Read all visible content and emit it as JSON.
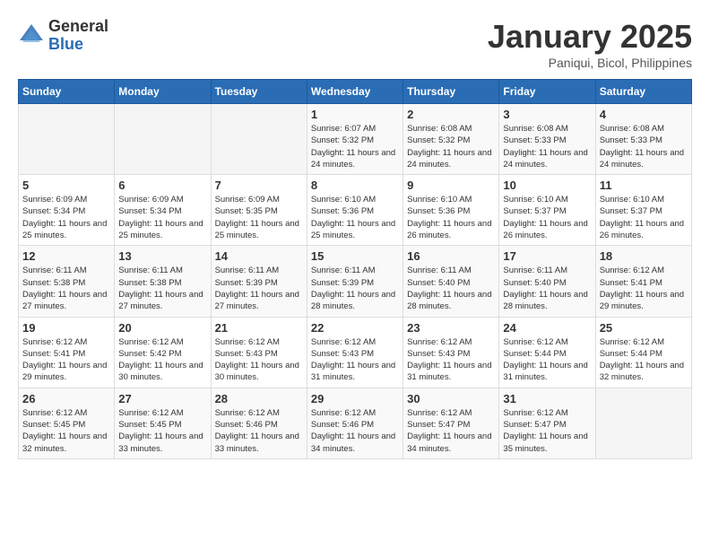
{
  "header": {
    "logo_general": "General",
    "logo_blue": "Blue",
    "month_title": "January 2025",
    "location": "Paniqui, Bicol, Philippines"
  },
  "weekdays": [
    "Sunday",
    "Monday",
    "Tuesday",
    "Wednesday",
    "Thursday",
    "Friday",
    "Saturday"
  ],
  "weeks": [
    [
      {
        "day": "",
        "sunrise": "",
        "sunset": "",
        "daylight": ""
      },
      {
        "day": "",
        "sunrise": "",
        "sunset": "",
        "daylight": ""
      },
      {
        "day": "",
        "sunrise": "",
        "sunset": "",
        "daylight": ""
      },
      {
        "day": "1",
        "sunrise": "Sunrise: 6:07 AM",
        "sunset": "Sunset: 5:32 PM",
        "daylight": "Daylight: 11 hours and 24 minutes."
      },
      {
        "day": "2",
        "sunrise": "Sunrise: 6:08 AM",
        "sunset": "Sunset: 5:32 PM",
        "daylight": "Daylight: 11 hours and 24 minutes."
      },
      {
        "day": "3",
        "sunrise": "Sunrise: 6:08 AM",
        "sunset": "Sunset: 5:33 PM",
        "daylight": "Daylight: 11 hours and 24 minutes."
      },
      {
        "day": "4",
        "sunrise": "Sunrise: 6:08 AM",
        "sunset": "Sunset: 5:33 PM",
        "daylight": "Daylight: 11 hours and 24 minutes."
      }
    ],
    [
      {
        "day": "5",
        "sunrise": "Sunrise: 6:09 AM",
        "sunset": "Sunset: 5:34 PM",
        "daylight": "Daylight: 11 hours and 25 minutes."
      },
      {
        "day": "6",
        "sunrise": "Sunrise: 6:09 AM",
        "sunset": "Sunset: 5:34 PM",
        "daylight": "Daylight: 11 hours and 25 minutes."
      },
      {
        "day": "7",
        "sunrise": "Sunrise: 6:09 AM",
        "sunset": "Sunset: 5:35 PM",
        "daylight": "Daylight: 11 hours and 25 minutes."
      },
      {
        "day": "8",
        "sunrise": "Sunrise: 6:10 AM",
        "sunset": "Sunset: 5:36 PM",
        "daylight": "Daylight: 11 hours and 25 minutes."
      },
      {
        "day": "9",
        "sunrise": "Sunrise: 6:10 AM",
        "sunset": "Sunset: 5:36 PM",
        "daylight": "Daylight: 11 hours and 26 minutes."
      },
      {
        "day": "10",
        "sunrise": "Sunrise: 6:10 AM",
        "sunset": "Sunset: 5:37 PM",
        "daylight": "Daylight: 11 hours and 26 minutes."
      },
      {
        "day": "11",
        "sunrise": "Sunrise: 6:10 AM",
        "sunset": "Sunset: 5:37 PM",
        "daylight": "Daylight: 11 hours and 26 minutes."
      }
    ],
    [
      {
        "day": "12",
        "sunrise": "Sunrise: 6:11 AM",
        "sunset": "Sunset: 5:38 PM",
        "daylight": "Daylight: 11 hours and 27 minutes."
      },
      {
        "day": "13",
        "sunrise": "Sunrise: 6:11 AM",
        "sunset": "Sunset: 5:38 PM",
        "daylight": "Daylight: 11 hours and 27 minutes."
      },
      {
        "day": "14",
        "sunrise": "Sunrise: 6:11 AM",
        "sunset": "Sunset: 5:39 PM",
        "daylight": "Daylight: 11 hours and 27 minutes."
      },
      {
        "day": "15",
        "sunrise": "Sunrise: 6:11 AM",
        "sunset": "Sunset: 5:39 PM",
        "daylight": "Daylight: 11 hours and 28 minutes."
      },
      {
        "day": "16",
        "sunrise": "Sunrise: 6:11 AM",
        "sunset": "Sunset: 5:40 PM",
        "daylight": "Daylight: 11 hours and 28 minutes."
      },
      {
        "day": "17",
        "sunrise": "Sunrise: 6:11 AM",
        "sunset": "Sunset: 5:40 PM",
        "daylight": "Daylight: 11 hours and 28 minutes."
      },
      {
        "day": "18",
        "sunrise": "Sunrise: 6:12 AM",
        "sunset": "Sunset: 5:41 PM",
        "daylight": "Daylight: 11 hours and 29 minutes."
      }
    ],
    [
      {
        "day": "19",
        "sunrise": "Sunrise: 6:12 AM",
        "sunset": "Sunset: 5:41 PM",
        "daylight": "Daylight: 11 hours and 29 minutes."
      },
      {
        "day": "20",
        "sunrise": "Sunrise: 6:12 AM",
        "sunset": "Sunset: 5:42 PM",
        "daylight": "Daylight: 11 hours and 30 minutes."
      },
      {
        "day": "21",
        "sunrise": "Sunrise: 6:12 AM",
        "sunset": "Sunset: 5:43 PM",
        "daylight": "Daylight: 11 hours and 30 minutes."
      },
      {
        "day": "22",
        "sunrise": "Sunrise: 6:12 AM",
        "sunset": "Sunset: 5:43 PM",
        "daylight": "Daylight: 11 hours and 31 minutes."
      },
      {
        "day": "23",
        "sunrise": "Sunrise: 6:12 AM",
        "sunset": "Sunset: 5:43 PM",
        "daylight": "Daylight: 11 hours and 31 minutes."
      },
      {
        "day": "24",
        "sunrise": "Sunrise: 6:12 AM",
        "sunset": "Sunset: 5:44 PM",
        "daylight": "Daylight: 11 hours and 31 minutes."
      },
      {
        "day": "25",
        "sunrise": "Sunrise: 6:12 AM",
        "sunset": "Sunset: 5:44 PM",
        "daylight": "Daylight: 11 hours and 32 minutes."
      }
    ],
    [
      {
        "day": "26",
        "sunrise": "Sunrise: 6:12 AM",
        "sunset": "Sunset: 5:45 PM",
        "daylight": "Daylight: 11 hours and 32 minutes."
      },
      {
        "day": "27",
        "sunrise": "Sunrise: 6:12 AM",
        "sunset": "Sunset: 5:45 PM",
        "daylight": "Daylight: 11 hours and 33 minutes."
      },
      {
        "day": "28",
        "sunrise": "Sunrise: 6:12 AM",
        "sunset": "Sunset: 5:46 PM",
        "daylight": "Daylight: 11 hours and 33 minutes."
      },
      {
        "day": "29",
        "sunrise": "Sunrise: 6:12 AM",
        "sunset": "Sunset: 5:46 PM",
        "daylight": "Daylight: 11 hours and 34 minutes."
      },
      {
        "day": "30",
        "sunrise": "Sunrise: 6:12 AM",
        "sunset": "Sunset: 5:47 PM",
        "daylight": "Daylight: 11 hours and 34 minutes."
      },
      {
        "day": "31",
        "sunrise": "Sunrise: 6:12 AM",
        "sunset": "Sunset: 5:47 PM",
        "daylight": "Daylight: 11 hours and 35 minutes."
      },
      {
        "day": "",
        "sunrise": "",
        "sunset": "",
        "daylight": ""
      }
    ]
  ]
}
